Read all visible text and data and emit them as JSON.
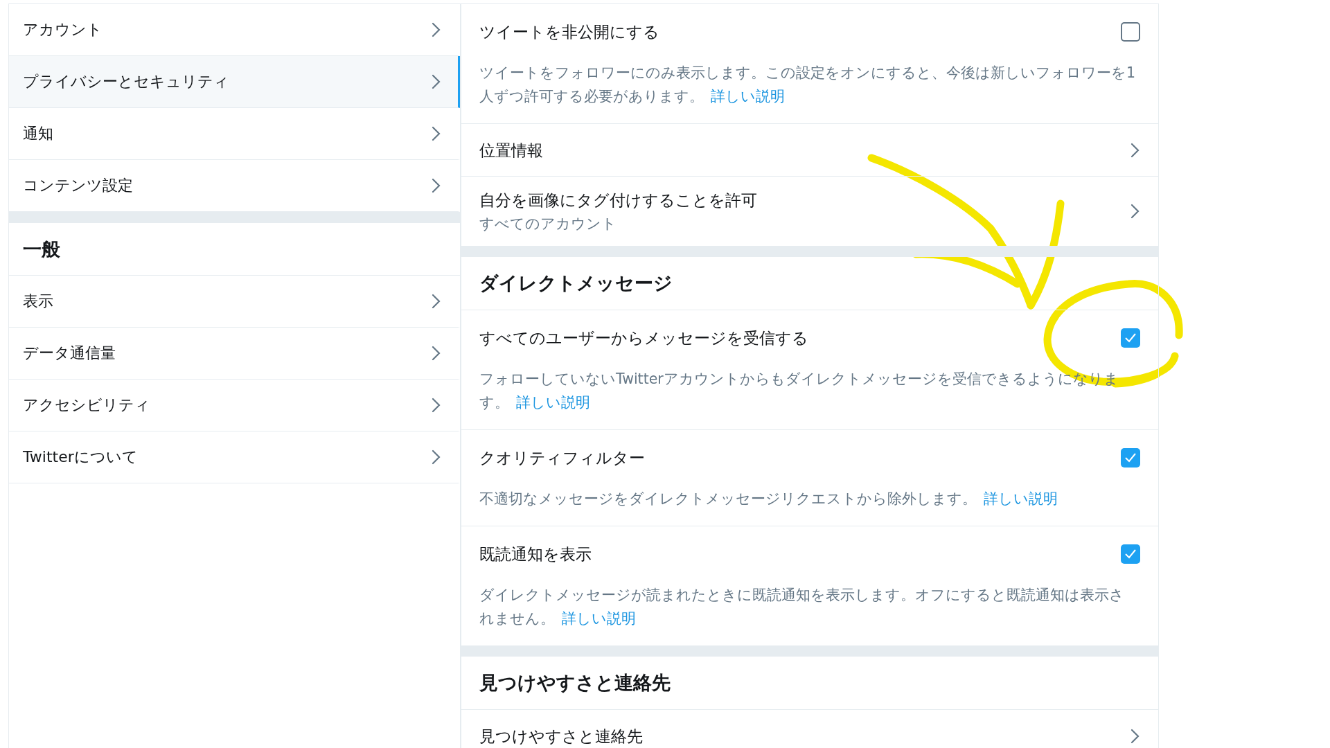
{
  "sidebar": {
    "groups": [
      {
        "items": [
          {
            "label": "アカウント",
            "selected": false
          },
          {
            "label": "プライバシーとセキュリティ",
            "selected": true
          },
          {
            "label": "通知",
            "selected": false
          },
          {
            "label": "コンテンツ設定",
            "selected": false
          }
        ]
      },
      {
        "heading": "一般",
        "items": [
          {
            "label": "表示",
            "selected": false
          },
          {
            "label": "データ通信量",
            "selected": false
          },
          {
            "label": "アクセシビリティ",
            "selected": false
          },
          {
            "label": "Twitterについて",
            "selected": false
          }
        ]
      }
    ]
  },
  "settings": {
    "sections": [
      {
        "items": [
          {
            "kind": "checkbox",
            "title": "ツイートを非公開にする",
            "checked": false,
            "description": "ツイートをフォロワーにのみ表示します。この設定をオンにすると、今後は新しいフォロワーを1人ずつ許可する必要があります。",
            "link": "詳しい説明"
          },
          {
            "kind": "link",
            "title": "位置情報"
          },
          {
            "kind": "link",
            "title": "自分を画像にタグ付けすることを許可",
            "subtitle": "すべてのアカウント"
          }
        ]
      },
      {
        "heading": "ダイレクトメッセージ",
        "items": [
          {
            "kind": "checkbox",
            "title": "すべてのユーザーからメッセージを受信する",
            "checked": true,
            "description": "フォローしていないTwitterアカウントからもダイレクトメッセージを受信できるようになります。",
            "link": "詳しい説明"
          },
          {
            "kind": "checkbox",
            "title": "クオリティフィルター",
            "checked": true,
            "description": "不適切なメッセージをダイレクトメッセージリクエストから除外します。",
            "link": "詳しい説明"
          },
          {
            "kind": "checkbox",
            "title": "既読通知を表示",
            "checked": true,
            "description": "ダイレクトメッセージが読まれたときに既読通知を表示します。オフにすると既読通知は表示されません。",
            "link": "詳しい説明"
          }
        ]
      },
      {
        "heading": "見つけやすさと連絡先",
        "items": [
          {
            "kind": "link",
            "title": "見つけやすさと連絡先"
          }
        ]
      }
    ]
  }
}
